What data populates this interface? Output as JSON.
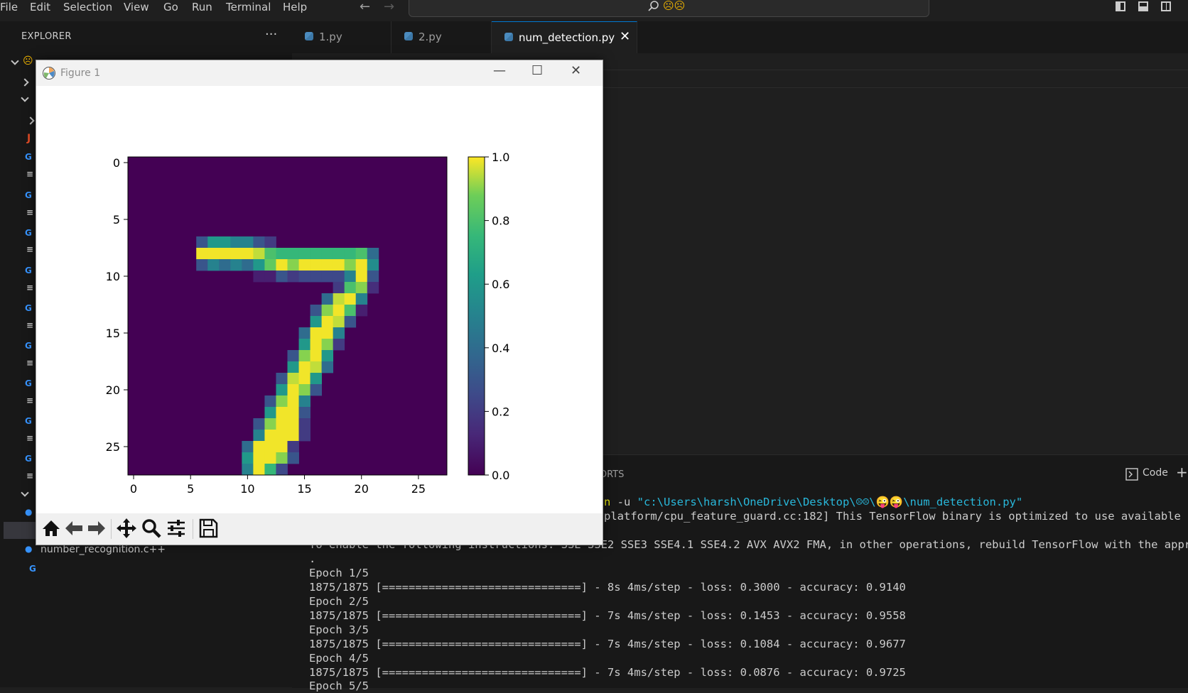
{
  "menu": {
    "items": [
      "File",
      "Edit",
      "Selection",
      "View",
      "Go",
      "Run",
      "Terminal",
      "Help"
    ]
  },
  "title_bar": {
    "emoji": "☹☹",
    "icons": [
      "arrow-left-icon",
      "arrow-right-icon",
      "search-icon",
      "toggle-sidebar-icon",
      "toggle-panel-icon",
      "toggle-secondary-sidebar-icon"
    ]
  },
  "sidebar": {
    "title": "EXPLORER",
    "more": "···",
    "visible_file": "number_recognition.c++"
  },
  "tabs": [
    {
      "label": "1.py",
      "active": false
    },
    {
      "label": "2.py",
      "active": false
    },
    {
      "label": "num_detection.py",
      "active": true
    }
  ],
  "tab_close": "✕",
  "panel": {
    "tab_label": "PORTS",
    "code_label": "Code",
    "add": "+"
  },
  "terminal": {
    "line0_prefix": "n",
    "line0_mid": " -u ",
    "line0_path": "\"c:\\Users\\harsh\\OneDrive\\Desktop\\☹☹\\😜😜\\num_detection.py\"",
    "line1": "platform/cpu_feature_guard.cc:182] This TensorFlow binary is optimized to use available CPU",
    "line2": "To enable the following instructions: SSE SSE2 SSE3 SSE4.1 SSE4.2 AVX AVX2 FMA, in other operations, rebuild TensorFlow with the appropri",
    "line3": ".",
    "lines": [
      "Epoch 1/5",
      "1875/1875 [==============================] - 8s 4ms/step - loss: 0.3000 - accuracy: 0.9140",
      "Epoch 2/5",
      "1875/1875 [==============================] - 7s 4ms/step - loss: 0.1453 - accuracy: 0.9558",
      "Epoch 3/5",
      "1875/1875 [==============================] - 7s 4ms/step - loss: 0.1084 - accuracy: 0.9677",
      "Epoch 4/5",
      "1875/1875 [==============================] - 7s 4ms/step - loss: 0.0876 - accuracy: 0.9725",
      "Epoch 5/5"
    ]
  },
  "figure_window": {
    "title": "Figure 1",
    "controls": {
      "minimize": "—",
      "maximize": "☐",
      "close": "✕"
    },
    "toolbar": [
      "home-icon",
      "back-icon",
      "forward-icon",
      "pan-icon",
      "zoom-icon",
      "configure-icon",
      "save-icon"
    ]
  },
  "chart_data": {
    "type": "heatmap",
    "colormap": "viridis",
    "shape": [
      28,
      28
    ],
    "xticks": [
      0,
      5,
      10,
      15,
      20,
      25
    ],
    "yticks": [
      0,
      5,
      10,
      15,
      20,
      25
    ],
    "colorbar": {
      "ticks": [
        "0.0",
        "0.2",
        "0.4",
        "0.6",
        "0.8",
        "1.0"
      ],
      "range": [
        0,
        1
      ]
    },
    "rows": [
      {
        "row": 7,
        "cells": [
          [
            6,
            0.3
          ],
          [
            7,
            0.6
          ],
          [
            8,
            0.6
          ],
          [
            9,
            0.5
          ],
          [
            10,
            0.5
          ],
          [
            11,
            0.3
          ],
          [
            12,
            0.2
          ]
        ]
      },
      {
        "row": 8,
        "cells": [
          [
            6,
            0.99
          ],
          [
            7,
            0.99
          ],
          [
            8,
            0.99
          ],
          [
            9,
            0.99
          ],
          [
            10,
            0.99
          ],
          [
            11,
            0.95
          ],
          [
            12,
            0.8
          ],
          [
            13,
            0.75
          ],
          [
            14,
            0.75
          ],
          [
            15,
            0.75
          ],
          [
            16,
            0.75
          ],
          [
            17,
            0.75
          ],
          [
            18,
            0.75
          ],
          [
            19,
            0.75
          ],
          [
            20,
            0.8
          ],
          [
            21,
            0.4
          ]
        ]
      },
      {
        "row": 9,
        "cells": [
          [
            6,
            0.3
          ],
          [
            7,
            0.5
          ],
          [
            8,
            0.4
          ],
          [
            9,
            0.5
          ],
          [
            10,
            0.4
          ],
          [
            11,
            0.6
          ],
          [
            12,
            0.85
          ],
          [
            13,
            0.99
          ],
          [
            14,
            0.9
          ],
          [
            15,
            0.99
          ],
          [
            16,
            0.99
          ],
          [
            17,
            0.99
          ],
          [
            18,
            0.99
          ],
          [
            19,
            0.9
          ],
          [
            20,
            0.99
          ],
          [
            21,
            0.55
          ]
        ]
      },
      {
        "row": 10,
        "cells": [
          [
            11,
            0.1
          ],
          [
            12,
            0.1
          ],
          [
            13,
            0.3
          ],
          [
            14,
            0.2
          ],
          [
            15,
            0.25
          ],
          [
            16,
            0.25
          ],
          [
            17,
            0.25
          ],
          [
            18,
            0.25
          ],
          [
            19,
            0.5
          ],
          [
            20,
            0.99
          ],
          [
            21,
            0.3
          ]
        ]
      },
      {
        "row": 11,
        "cells": [
          [
            18,
            0.2
          ],
          [
            19,
            0.8
          ],
          [
            20,
            0.9
          ],
          [
            21,
            0.15
          ]
        ]
      },
      {
        "row": 12,
        "cells": [
          [
            17,
            0.4
          ],
          [
            18,
            0.95
          ],
          [
            19,
            0.99
          ],
          [
            20,
            0.5
          ]
        ]
      },
      {
        "row": 13,
        "cells": [
          [
            16,
            0.3
          ],
          [
            17,
            0.9
          ],
          [
            18,
            0.99
          ],
          [
            19,
            0.8
          ],
          [
            20,
            0.1
          ]
        ]
      },
      {
        "row": 14,
        "cells": [
          [
            16,
            0.6
          ],
          [
            17,
            0.99
          ],
          [
            18,
            0.95
          ],
          [
            19,
            0.3
          ]
        ]
      },
      {
        "row": 15,
        "cells": [
          [
            15,
            0.4
          ],
          [
            16,
            0.99
          ],
          [
            17,
            0.99
          ],
          [
            18,
            0.5
          ]
        ]
      },
      {
        "row": 16,
        "cells": [
          [
            15,
            0.6
          ],
          [
            16,
            0.99
          ],
          [
            17,
            0.9
          ],
          [
            18,
            0.2
          ]
        ]
      },
      {
        "row": 17,
        "cells": [
          [
            14,
            0.3
          ],
          [
            15,
            0.9
          ],
          [
            16,
            0.99
          ],
          [
            17,
            0.6
          ]
        ]
      },
      {
        "row": 18,
        "cells": [
          [
            14,
            0.6
          ],
          [
            15,
            0.99
          ],
          [
            16,
            0.95
          ],
          [
            17,
            0.4
          ]
        ]
      },
      {
        "row": 19,
        "cells": [
          [
            13,
            0.3
          ],
          [
            14,
            0.95
          ],
          [
            15,
            0.99
          ],
          [
            16,
            0.6
          ]
        ]
      },
      {
        "row": 20,
        "cells": [
          [
            13,
            0.6
          ],
          [
            14,
            0.99
          ],
          [
            15,
            0.9
          ],
          [
            16,
            0.3
          ]
        ]
      },
      {
        "row": 21,
        "cells": [
          [
            12,
            0.3
          ],
          [
            13,
            0.9
          ],
          [
            14,
            0.99
          ],
          [
            15,
            0.5
          ]
        ]
      },
      {
        "row": 22,
        "cells": [
          [
            12,
            0.6
          ],
          [
            13,
            0.99
          ],
          [
            14,
            0.99
          ],
          [
            15,
            0.3
          ]
        ]
      },
      {
        "row": 23,
        "cells": [
          [
            11,
            0.3
          ],
          [
            12,
            0.9
          ],
          [
            13,
            0.99
          ],
          [
            14,
            0.99
          ],
          [
            15,
            0.2
          ]
        ]
      },
      {
        "row": 24,
        "cells": [
          [
            11,
            0.5
          ],
          [
            12,
            0.99
          ],
          [
            13,
            0.99
          ],
          [
            14,
            0.99
          ],
          [
            15,
            0.2
          ]
        ]
      },
      {
        "row": 25,
        "cells": [
          [
            10,
            0.4
          ],
          [
            11,
            0.99
          ],
          [
            12,
            0.99
          ],
          [
            13,
            0.99
          ],
          [
            14,
            0.2
          ]
        ]
      },
      {
        "row": 26,
        "cells": [
          [
            10,
            0.6
          ],
          [
            11,
            0.99
          ],
          [
            12,
            0.99
          ],
          [
            13,
            0.9
          ],
          [
            14,
            0.3
          ]
        ]
      },
      {
        "row": 27,
        "cells": [
          [
            10,
            0.5
          ],
          [
            11,
            0.99
          ],
          [
            12,
            0.75
          ],
          [
            13,
            0.25
          ]
        ]
      }
    ]
  }
}
